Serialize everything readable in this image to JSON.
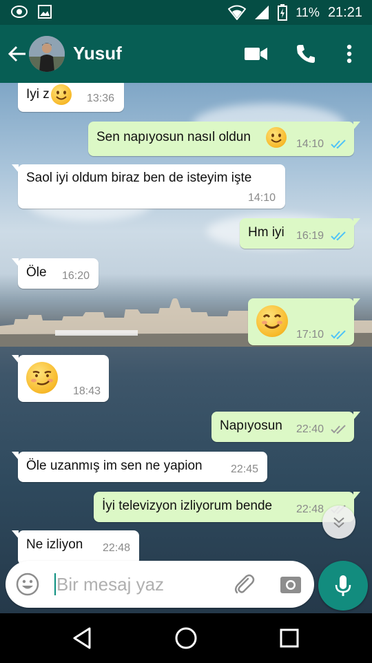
{
  "status_bar": {
    "battery": "11%",
    "time": "21:21"
  },
  "header": {
    "contact_name": "Yusuf"
  },
  "messages": [
    {
      "dir": "in",
      "text": "Iyi z",
      "emoji": true,
      "time": "13:36"
    },
    {
      "dir": "out",
      "text": "Sen napıyosun nasıl oldun",
      "emoji": true,
      "time": "14:10",
      "status": "read"
    },
    {
      "dir": "in",
      "text": "Saol iyi oldum biraz  ben de isteyim işte",
      "time": "14:10"
    },
    {
      "dir": "out",
      "text": "Hm iyi",
      "time": "16:19",
      "status": "read"
    },
    {
      "dir": "in",
      "text": "Öle",
      "time": "16:20"
    },
    {
      "dir": "out",
      "text": "",
      "emoji": true,
      "time": "17:10",
      "status": "read"
    },
    {
      "dir": "in",
      "text": "",
      "emoji": true,
      "time": "18:43"
    },
    {
      "dir": "out",
      "text": "Napıyosun",
      "time": "22:40",
      "status": "delivered"
    },
    {
      "dir": "in",
      "text": "Öle uzanmış im sen ne yapion",
      "time": "22:45"
    },
    {
      "dir": "out",
      "text": "İyi televizyon izliyorum bende",
      "time": "22:48",
      "status": "delivered"
    },
    {
      "dir": "in",
      "text": "Ne izliyon",
      "time": "22:48"
    }
  ],
  "composer": {
    "placeholder": "Bir mesaj yaz"
  },
  "colors": {
    "header": "#075e54",
    "status_bar": "#054d44",
    "bubble_out": "#dcf8c6",
    "bubble_in": "#ffffff",
    "read_ticks": "#4fc3f7",
    "mic_button": "#128c7e"
  },
  "icons": [
    "back-arrow-icon",
    "video-call-icon",
    "phone-icon",
    "more-vert-icon",
    "emoji-icon",
    "attach-icon",
    "camera-icon",
    "mic-icon",
    "chevron-down-icon"
  ]
}
